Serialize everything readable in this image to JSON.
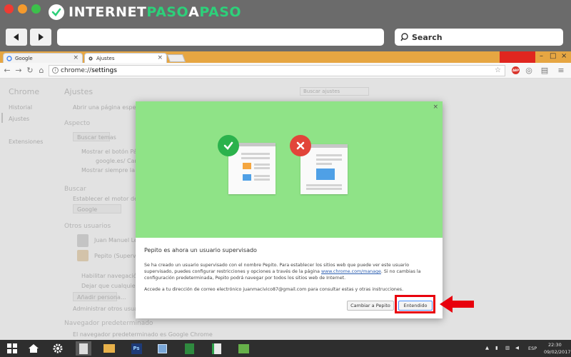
{
  "logo": {
    "part1": "INTERNET",
    "part2": "PASO",
    "part3": "A",
    "part4": "PASO"
  },
  "mock_search": {
    "placeholder": "Search"
  },
  "colors": {
    "accent_green": "#2dd07a",
    "red": "#e8000d",
    "illustration_bg": "#8fe387"
  },
  "tabs": [
    {
      "label": "Google",
      "icon": "google-icon"
    },
    {
      "label": "Ajustes",
      "icon": "gear-icon"
    }
  ],
  "address": {
    "url_host": "chrome://",
    "url_path": "settings"
  },
  "settings_page": {
    "sidebar_title": "Chrome",
    "sidebar_item1": "Historial",
    "sidebar_item2": "Ajustes",
    "sidebar_item3": "Extensiones",
    "title": "Ajustes",
    "search_placeholder": "Buscar ajustes",
    "startup": "Abrir una página específica",
    "appearance": "Aspecto",
    "get_themes": "Buscar temas",
    "show_home": "Mostrar el botón Página de inicio",
    "home_google": "google.es/ Cambiar",
    "show_bookmarks": "Mostrar siempre la barra",
    "search_heading": "Buscar",
    "search_engine_desc": "Establecer el motor de búsqueda",
    "search_engine_value": "Google",
    "others_heading": "Otros usuarios",
    "user_name": "Juan Manuel Lecha",
    "user_pepito": "Pepito (Supervisado)",
    "guest_browsing": "Habilitar navegación como invitado",
    "let_anyone": "Dejar que cualquier persona añada",
    "add_person": "Añadir persona...",
    "manage_others": "Administrar otros usuarios",
    "default_browser_heading": "Navegador predeterminado",
    "default_browser_desc": "El navegador predeterminado es Google Chrome"
  },
  "dialog": {
    "title": "Pepito es ahora un usuario supervisado",
    "paragraph1_a": "Se ha creado un usuario supervisado con el nombre Pepito. Para establecer los sitios web que puede ver este usuario supervisado, puedes configurar restricciones y opciones a través de la página ",
    "paragraph1_link": "www.chrome.com/manage",
    "paragraph1_b": ". Si no cambias la configuración predeterminada, Pepito podrá navegar por todos los sitios web de Internet.",
    "paragraph2": "Accede a tu dirección de correo electrónico juanmacivico87@gmail.com para consultar estas y otras instrucciones.",
    "switch_button": "Cambiar a Pepito",
    "ok_button": "Entendido"
  },
  "taskbar": {
    "language": "ESP",
    "time": "22:30",
    "date": "09/02/2017"
  }
}
